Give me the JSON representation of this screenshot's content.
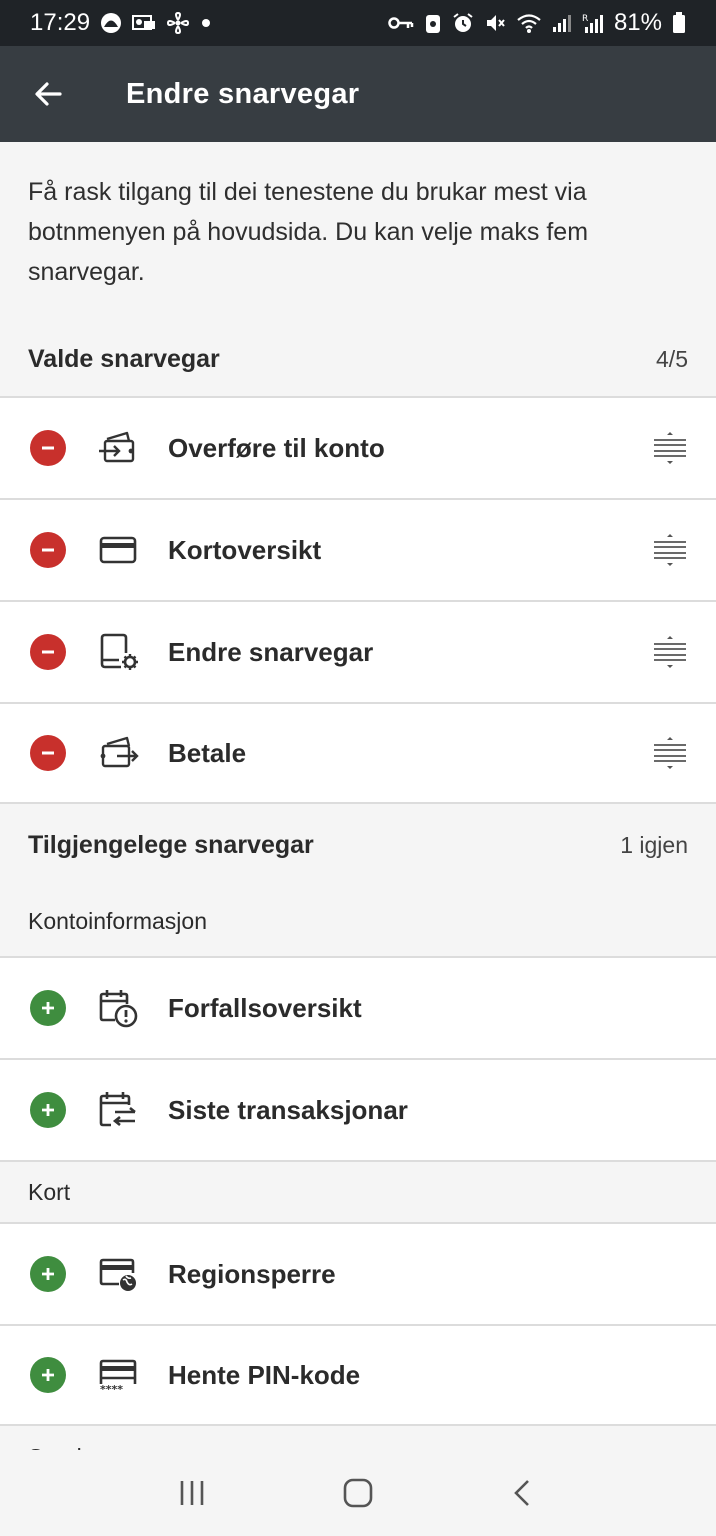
{
  "status_bar": {
    "time": "17:29",
    "battery": "81%",
    "icons_left": [
      "app-icon",
      "message-icon",
      "fan-icon",
      "dot-icon"
    ],
    "icons_right": [
      "key-icon",
      "security-icon",
      "alarm-icon",
      "mute-icon",
      "wifi-icon",
      "signal-icon",
      "signal-roaming-icon",
      "battery-icon"
    ]
  },
  "app_bar": {
    "title": "Endre snarvegar",
    "back_icon": "arrow-left-icon"
  },
  "intro_text": "Få rask tilgang til dei tenestene du brukar mest via botnmenyen på hovudsida. Du kan velje maks fem snarvegar.",
  "selected": {
    "title": "Valde snarvegar",
    "count": "4/5",
    "items": [
      {
        "label": "Overføre til konto",
        "icon": "transfer-account-icon"
      },
      {
        "label": "Kortoversikt",
        "icon": "card-icon"
      },
      {
        "label": "Endre snarvegar",
        "icon": "device-settings-icon"
      },
      {
        "label": "Betale",
        "icon": "pay-icon"
      }
    ]
  },
  "available": {
    "title": "Tilgjengelege snarvegar",
    "count": "1 igjen",
    "groups": [
      {
        "title": "Kontoinformasjon",
        "items": [
          {
            "label": "Forfallsoversikt",
            "icon": "calendar-alert-icon"
          },
          {
            "label": "Siste transaksjonar",
            "icon": "calendar-transfer-icon"
          }
        ]
      },
      {
        "title": "Kort",
        "items": [
          {
            "label": "Regionsperre",
            "icon": "card-globe-icon"
          },
          {
            "label": "Hente PIN-kode",
            "icon": "card-pin-icon"
          }
        ]
      },
      {
        "title": "Sparing",
        "items": []
      }
    ]
  },
  "colors": {
    "status_bar": "#1f2327",
    "app_bar": "#373d42",
    "remove": "#c8302c",
    "add": "#3f8d3f",
    "background": "#f5f5f5"
  },
  "nav_bar": {
    "recents_icon": "recents-icon",
    "home_icon": "home-icon",
    "back_icon": "back-chevron-icon"
  }
}
